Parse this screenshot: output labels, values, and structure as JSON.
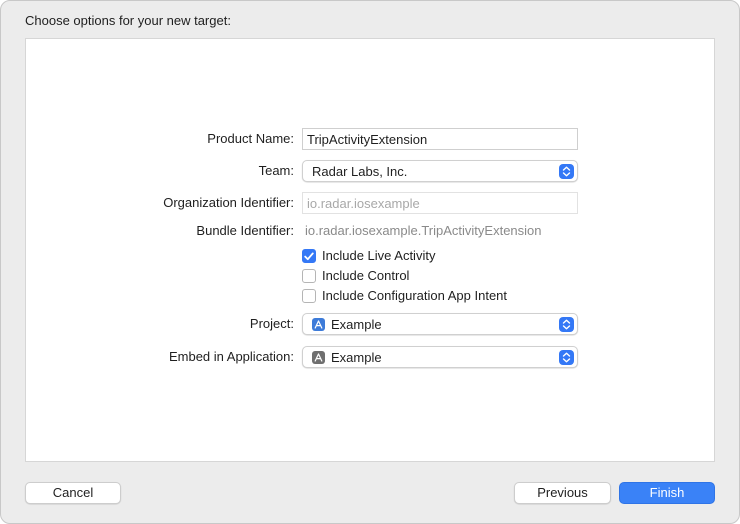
{
  "window": {
    "title": "Choose options for your new target:"
  },
  "form": {
    "product_name": {
      "label": "Product Name:",
      "value": "TripActivityExtension"
    },
    "team": {
      "label": "Team:",
      "value": "Radar Labs, Inc."
    },
    "organization_identifier": {
      "label": "Organization Identifier:",
      "placeholder": "io.radar.iosexample",
      "value": ""
    },
    "bundle_identifier": {
      "label": "Bundle Identifier:",
      "value": "io.radar.iosexample.TripActivityExtension"
    },
    "checkboxes": [
      {
        "label": "Include Live Activity",
        "checked": true
      },
      {
        "label": "Include Control",
        "checked": false
      },
      {
        "label": "Include Configuration App Intent",
        "checked": false
      }
    ],
    "project": {
      "label": "Project:",
      "value": "Example",
      "icon": "xcode-project-icon"
    },
    "embed_in_application": {
      "label": "Embed in Application:",
      "value": "Example",
      "icon": "app-icon"
    }
  },
  "buttons": {
    "cancel": "Cancel",
    "previous": "Previous",
    "finish": "Finish"
  },
  "colors": {
    "accent": "#3478f6",
    "primary_button": "#3a82f7",
    "window_background": "#ececec",
    "panel_background": "#ffffff"
  }
}
